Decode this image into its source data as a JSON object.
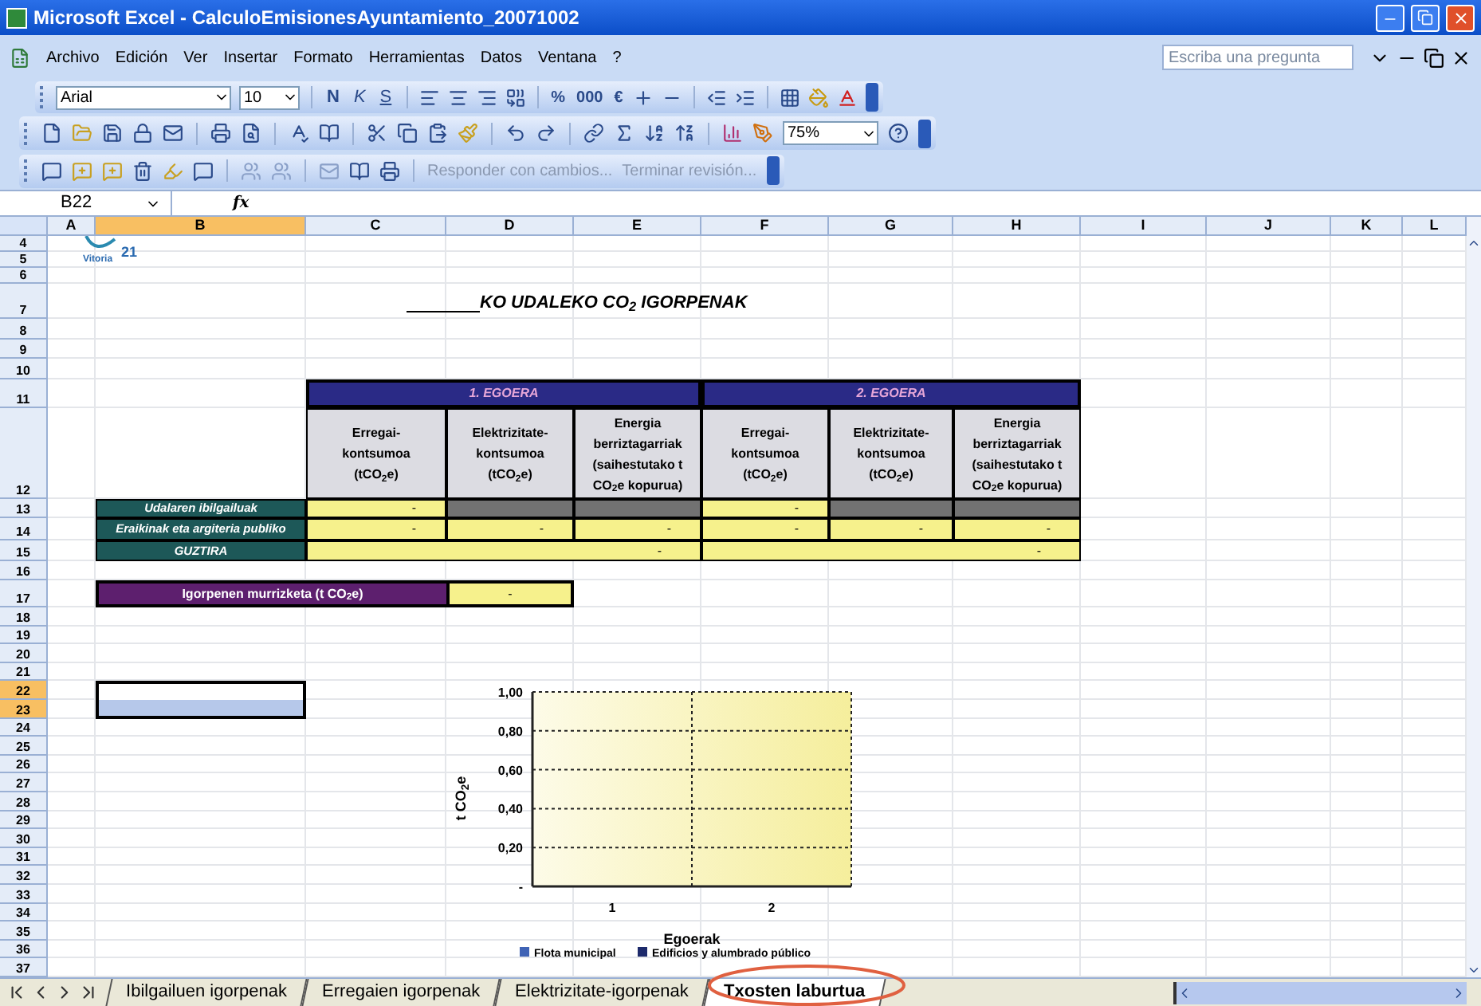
{
  "window": {
    "title": "Microsoft Excel - CalculoEmisionesAyuntamiento_20071002"
  },
  "menu": [
    "Archivo",
    "Edición",
    "Ver",
    "Insertar",
    "Formato",
    "Herramientas",
    "Datos",
    "Ventana",
    "?"
  ],
  "help_box": {
    "placeholder": "Escriba una pregunta"
  },
  "format_toolbar": {
    "font": "Arial",
    "size": "10",
    "style_buttons": [
      "N",
      "K",
      "S"
    ],
    "number_buttons": [
      "%",
      "000",
      "€"
    ]
  },
  "standard_toolbar": {
    "zoom": "75%"
  },
  "review_toolbar": {
    "reply": "Responder con cambios...",
    "end": "Terminar revisión..."
  },
  "formula_bar": {
    "name_box": "B22",
    "fx": "fx"
  },
  "columns": [
    {
      "label": "A",
      "selected": false
    },
    {
      "label": "B",
      "selected": true
    },
    {
      "label": "C",
      "selected": false
    },
    {
      "label": "D",
      "selected": false
    },
    {
      "label": "E",
      "selected": false
    },
    {
      "label": "F",
      "selected": false
    },
    {
      "label": "G",
      "selected": false
    },
    {
      "label": "H",
      "selected": false
    },
    {
      "label": "I",
      "selected": false
    },
    {
      "label": "J",
      "selected": false
    },
    {
      "label": "K",
      "selected": false
    },
    {
      "label": "L",
      "selected": false
    }
  ],
  "rows": [
    {
      "label": "4",
      "selected": false
    },
    {
      "label": "5",
      "selected": false
    },
    {
      "label": "6",
      "selected": false
    },
    {
      "label": "7",
      "selected": false
    },
    {
      "label": "8",
      "selected": false
    },
    {
      "label": "9",
      "selected": false
    },
    {
      "label": "10",
      "selected": false
    },
    {
      "label": "11",
      "selected": false
    },
    {
      "label": "12",
      "selected": false
    },
    {
      "label": "13",
      "selected": false
    },
    {
      "label": "14",
      "selected": false
    },
    {
      "label": "15",
      "selected": false
    },
    {
      "label": "16",
      "selected": false
    },
    {
      "label": "17",
      "selected": false
    },
    {
      "label": "18",
      "selected": false
    },
    {
      "label": "19",
      "selected": false
    },
    {
      "label": "20",
      "selected": false
    },
    {
      "label": "21",
      "selected": false
    },
    {
      "label": "22",
      "selected": true
    },
    {
      "label": "23",
      "selected": true
    },
    {
      "label": "24",
      "selected": false
    },
    {
      "label": "25",
      "selected": false
    },
    {
      "label": "26",
      "selected": false
    },
    {
      "label": "27",
      "selected": false
    },
    {
      "label": "28",
      "selected": false
    },
    {
      "label": "29",
      "selected": false
    },
    {
      "label": "30",
      "selected": false
    },
    {
      "label": "31",
      "selected": false
    },
    {
      "label": "32",
      "selected": false
    },
    {
      "label": "33",
      "selected": false
    },
    {
      "label": "34",
      "selected": false
    },
    {
      "label": "35",
      "selected": false
    },
    {
      "label": "36",
      "selected": false
    },
    {
      "label": "37",
      "selected": false
    }
  ],
  "logo": {
    "number": "21",
    "caption": "Vitoria"
  },
  "title": "KO UDALEKO CO$_{2}$ IGORPENAK",
  "table": {
    "groups": [
      "1. EGOERA",
      "2. EGOERA"
    ],
    "headers": [
      "Erregai-kontsumoa (tCO$_{2}$e)",
      "Elektrizitate-kontsumoa (tCO$_{2}$e)",
      "Energia berriztagarriak (saihestutako t CO$_{2}$e kopurua)",
      "Erregai-kontsumoa (tCO$_{2}$e)",
      "Elektrizitate-kontsumoa (tCO$_{2}$e)",
      "Energia berriztagarriak (saihestutako t CO$_{2}$e kopurua)"
    ],
    "rows": [
      {
        "label": "Udalaren ibilgailuak",
        "cells": [
          {
            "kind": "value",
            "text": "-"
          },
          {
            "kind": "disabled"
          },
          {
            "kind": "disabled"
          },
          {
            "kind": "value",
            "text": "-"
          },
          {
            "kind": "disabled"
          },
          {
            "kind": "disabled"
          }
        ]
      },
      {
        "label": "Eraikinak eta argiteria publiko",
        "cells": [
          {
            "kind": "value",
            "text": "-"
          },
          {
            "kind": "value",
            "text": "-"
          },
          {
            "kind": "value",
            "text": "-"
          },
          {
            "kind": "value",
            "text": "-"
          },
          {
            "kind": "value",
            "text": "-"
          },
          {
            "kind": "value",
            "text": "-"
          }
        ]
      },
      {
        "label": "GUZTIRA",
        "cells": [
          {
            "kind": "total",
            "text": "-"
          },
          {
            "kind": "total",
            "text": "-"
          }
        ]
      }
    ]
  },
  "reduction": {
    "label": "Igorpenen murrizketa (t CO$_{2}$e)",
    "value": "-"
  },
  "chart": {
    "chart_data": {
      "type": "bar",
      "grid": true,
      "xlabel": "Egoerak",
      "ylabel": "t CO$_{2}$e",
      "categories": [
        "1",
        "2"
      ],
      "series": [
        {
          "name": "Flota municipal",
          "color": "#3f63b5",
          "values": [
            null,
            null
          ]
        },
        {
          "name": "Edificios y alumbrado público",
          "color": "#1d2a6b",
          "values": [
            null,
            null
          ]
        }
      ],
      "ylim": [
        0,
        1
      ],
      "yticks": [
        {
          "value": 0,
          "label": "-"
        },
        {
          "value": 0.2,
          "label": "0,20"
        },
        {
          "value": 0.4,
          "label": "0,40"
        },
        {
          "value": 0.6,
          "label": "0,60"
        },
        {
          "value": 0.8,
          "label": "0,80"
        },
        {
          "value": 1,
          "label": "1,00"
        }
      ]
    }
  },
  "sheet_tabs": [
    {
      "label": "Ibilgailuen igorpenak",
      "selected": false
    },
    {
      "label": "Erregaien igorpenak",
      "selected": false
    },
    {
      "label": "Elektrizitate-igorpenak",
      "selected": false
    },
    {
      "label": "Txosten laburtua",
      "selected": true
    }
  ]
}
